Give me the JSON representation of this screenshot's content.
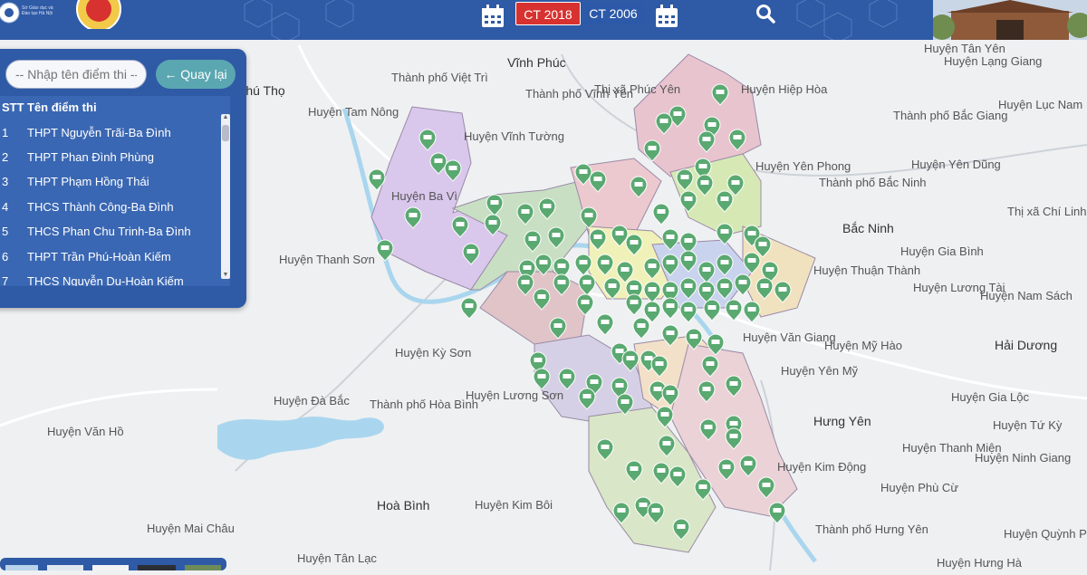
{
  "header": {
    "tabs": [
      {
        "label": "CT 2018",
        "active": true
      },
      {
        "label": "CT 2006",
        "active": false
      }
    ],
    "logo_text": "Sở Giáo dục và Đào tạo Hà Nội",
    "icons": {
      "calendar_left": "calendar-icon",
      "calendar_right": "calendar-icon",
      "search": "search-icon"
    },
    "colors": {
      "bar": "#2f5aa5",
      "active_tab": "#d7322f"
    }
  },
  "sidebar": {
    "search_placeholder": "-- Nhập tên điểm thi --",
    "back_label": "Quay lại",
    "back_icon": "arrow-left-icon",
    "columns": [
      "STT",
      "Tên điểm thi"
    ],
    "rows": [
      {
        "stt": "1",
        "name": "THPT Nguyễn Trãi-Ba Đình"
      },
      {
        "stt": "2",
        "name": "THPT Phan Đình Phùng"
      },
      {
        "stt": "3",
        "name": "THPT Phạm Hồng Thái"
      },
      {
        "stt": "4",
        "name": "THCS Thành Công-Ba Đình"
      },
      {
        "stt": "5",
        "name": "THCS Phan Chu Trinh-Ba Đình"
      },
      {
        "stt": "6",
        "name": "THPT Trần Phú-Hoàn Kiếm"
      },
      {
        "stt": "7",
        "name": "THCS Nguyễn Du-Hoàn Kiếm"
      }
    ]
  },
  "map": {
    "marker_icon": "school-marker-icon",
    "marker_color": "#5aa971",
    "labels": [
      "Huyện Tân Yên",
      "Huyện Lạng Giang",
      "Vĩnh Phúc",
      "Phú Thọ",
      "Thành phố Việt Trì",
      "Thành phố Vĩnh Yên",
      "Thị xã Phúc Yên",
      "Huyện Hiệp Hòa",
      "Huyện Lục Nam",
      "Huyện Tam Nông",
      "Huyện Vĩnh Tường",
      "Thành phố Bắc Giang",
      "Huyện Yên Dũng",
      "Huyện Yên Phong",
      "Thành phố Bắc Ninh",
      "Huyện Ba Vì",
      "Thị xã Chí Linh",
      "Bắc Ninh",
      "Huyện Thanh Sơn",
      "Huyện Gia Bình",
      "Huyện Thuận Thành",
      "Huyện Lương Tài",
      "Huyện Nam Sách",
      "Huyện Văn Giang",
      "Huyện Mỹ Hào",
      "Hải Dương",
      "Huyện Kỳ Sơn",
      "Huyện Yên Mỹ",
      "Huyện Lương Sơn",
      "Huyện Đà Bắc",
      "Thành phố Hòa Bình",
      "Huyện Gia Lộc",
      "Hưng Yên",
      "Huyện Tứ Kỳ",
      "Huyện Văn Hồ",
      "Huyện Thanh Miện",
      "Huyện Ninh Giang",
      "Huyện Kim Động",
      "Hoà Bình",
      "Huyện Kim Bôi",
      "Huyện Phù Cừ",
      "Huyện Mai Châu",
      "Thành phố Hưng Yên",
      "Huyện Quỳnh Phụ",
      "Huyện Tân Lạc",
      "Huyện Hưng Hà"
    ]
  }
}
